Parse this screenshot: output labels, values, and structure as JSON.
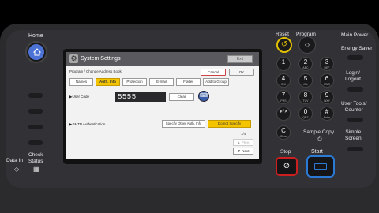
{
  "panel": {
    "home_label": "Home",
    "data_in_label": "Data In",
    "check_status_label": "Check\nStatus"
  },
  "screen": {
    "title": "System Settings",
    "exit_label": "Exit",
    "breadcrumb": "Program / Change Address Book",
    "cancel_label": "Cancel",
    "ok_label": "OK",
    "tabs": [
      "Names",
      "Auth. Info",
      "Protection",
      "E-mail",
      "Folder",
      "Add to Group"
    ],
    "active_tab": "Auth. Info",
    "user_code_label": "▶User Code",
    "user_code_value": "5555_",
    "clear_label": "Clear",
    "smtp_label": "▶SMTP Authentication",
    "specify_other_label": "Specify Other Auth. Info",
    "do_not_specify_label": "Do not Specify",
    "page_indicator": "1/4",
    "prev_label": "▲ Prev.",
    "next_label": "▼ Next"
  },
  "right": {
    "reset_label": "Reset",
    "program_label": "Program",
    "main_power_label": "Main Power",
    "energy_saver_label": "Energy Saver",
    "login_logout_label": "Login/\nLogout",
    "user_tools_label": "User Tools/\nCounter",
    "simple_screen_label": "Simple\nScreen",
    "sample_copy_label": "Sample Copy",
    "stop_label": "Stop",
    "start_label": "Start",
    "keys": [
      {
        "n": "1",
        "s": ""
      },
      {
        "n": "2",
        "s": "ABC"
      },
      {
        "n": "3",
        "s": "DEF"
      },
      {
        "n": "4",
        "s": "GHI"
      },
      {
        "n": "5",
        "s": "JKL"
      },
      {
        "n": "6",
        "s": "MNO"
      },
      {
        "n": "7",
        "s": "PRS"
      },
      {
        "n": "8",
        "s": "TUV"
      },
      {
        "n": "9",
        "s": "WXY"
      },
      {
        "n": "∗/✕",
        "s": ""
      },
      {
        "n": "0",
        "s": "QRZ"
      },
      {
        "n": "#",
        "s": "Enter"
      },
      {
        "n": "C",
        "s": "Clear"
      }
    ]
  }
}
